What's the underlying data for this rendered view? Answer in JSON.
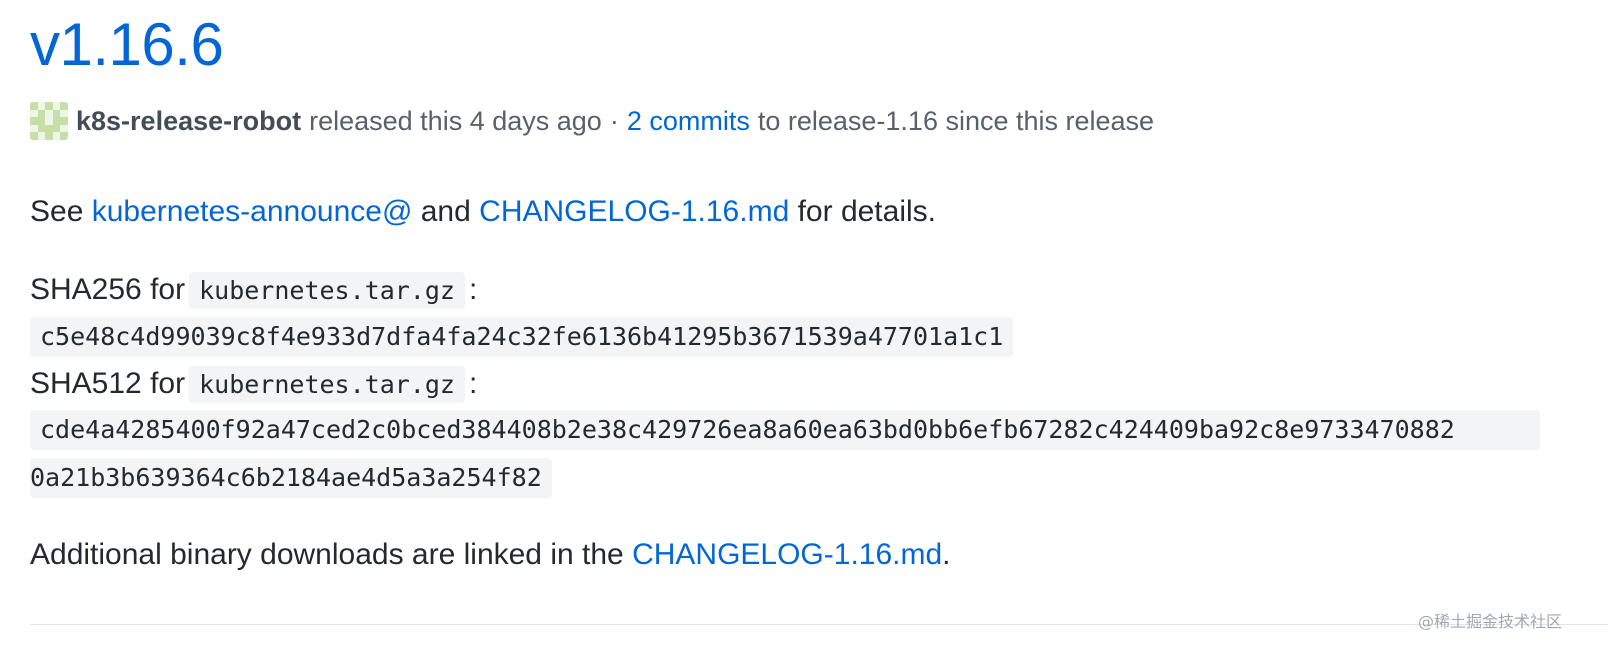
{
  "release": {
    "tag": "v1.16.6",
    "author": "k8s-release-robot",
    "released_text": "released this 4 days ago",
    "separator": "·",
    "commits_link": "2 commits",
    "commits_suffix": "to release-1.16 since this release"
  },
  "body": {
    "see_prefix": "See",
    "announce_link": "kubernetes-announce@",
    "and_text": "and",
    "changelog_link": "CHANGELOG-1.16.md",
    "details_suffix": "for details.",
    "sha256_prefix": "SHA256 for",
    "sha256_file": "kubernetes.tar.gz",
    "sha256_colon": ":",
    "sha256_value": "c5e48c4d99039c8f4e933d7dfa4fa24c32fe6136b41295b3671539a47701a1c1",
    "sha512_prefix": "SHA512 for",
    "sha512_file": "kubernetes.tar.gz",
    "sha512_colon": ":",
    "sha512_value_line1": "cde4a4285400f92a47ced2c0bced384408b2e38c429726ea8a60ea63bd0bb6efb67282c424409ba92c8e9733470882",
    "sha512_value_line2": "0a21b3b639364c6b2184ae4d5a3a254f82",
    "additional_prefix": "Additional binary downloads are linked in the",
    "additional_link": "CHANGELOG-1.16.md",
    "additional_suffix": "."
  },
  "watermark": "@稀土掘金技术社区",
  "colors": {
    "link": "#0366d6",
    "text": "#24292e",
    "muted": "#586069",
    "code_bg": "#f3f4f5",
    "avatar_green": "#c5dfa6"
  },
  "icons": {
    "avatar": "identicon-avatar"
  }
}
